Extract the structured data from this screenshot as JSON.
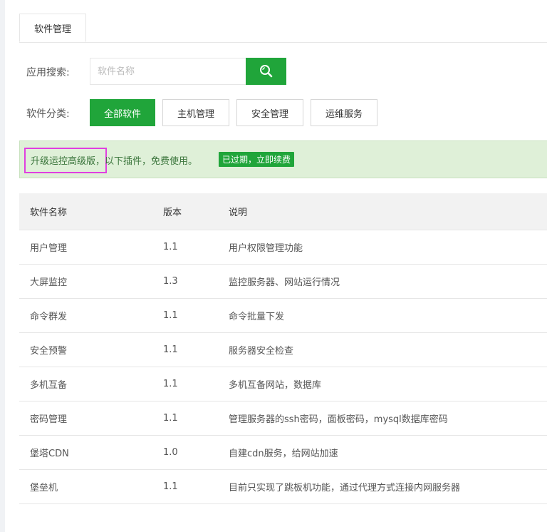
{
  "tabs": [
    {
      "label": "软件管理"
    }
  ],
  "search": {
    "label": "应用搜索:",
    "placeholder": "软件名称",
    "value": ""
  },
  "category": {
    "label": "软件分类:",
    "buttons": [
      {
        "label": "全部软件",
        "active": true
      },
      {
        "label": "主机管理",
        "active": false
      },
      {
        "label": "安全管理",
        "active": false
      },
      {
        "label": "运维服务",
        "active": false
      }
    ]
  },
  "notice": {
    "text_highlight": "升级运控高级版",
    "text_rest": "，以下插件，免费使用。",
    "badge": "已过期，立即续费"
  },
  "table": {
    "headers": [
      "软件名称",
      "版本",
      "说明"
    ],
    "rows": [
      {
        "name": "用户管理",
        "version": "1.1",
        "desc": "用户权限管理功能"
      },
      {
        "name": "大屏监控",
        "version": "1.3",
        "desc": "监控服务器、网站运行情况"
      },
      {
        "name": "命令群发",
        "version": "1.1",
        "desc": "命令批量下发"
      },
      {
        "name": "安全预警",
        "version": "1.1",
        "desc": "服务器安全检查"
      },
      {
        "name": "多机互备",
        "version": "1.1",
        "desc": "多机互备网站，数据库"
      },
      {
        "name": "密码管理",
        "version": "1.1",
        "desc": "管理服务器的ssh密码，面板密码，mysql数据库密码"
      },
      {
        "name": "堡塔CDN",
        "version": "1.0",
        "desc": "自建cdn服务，给网站加速"
      },
      {
        "name": "堡垒机",
        "version": "1.1",
        "desc": "目前只实现了跳板机功能，通过代理方式连接内网服务器"
      }
    ]
  },
  "colors": {
    "accent": "#20a53a",
    "notice_bg": "#dff0d8",
    "highlight_border": "#e040e0"
  }
}
